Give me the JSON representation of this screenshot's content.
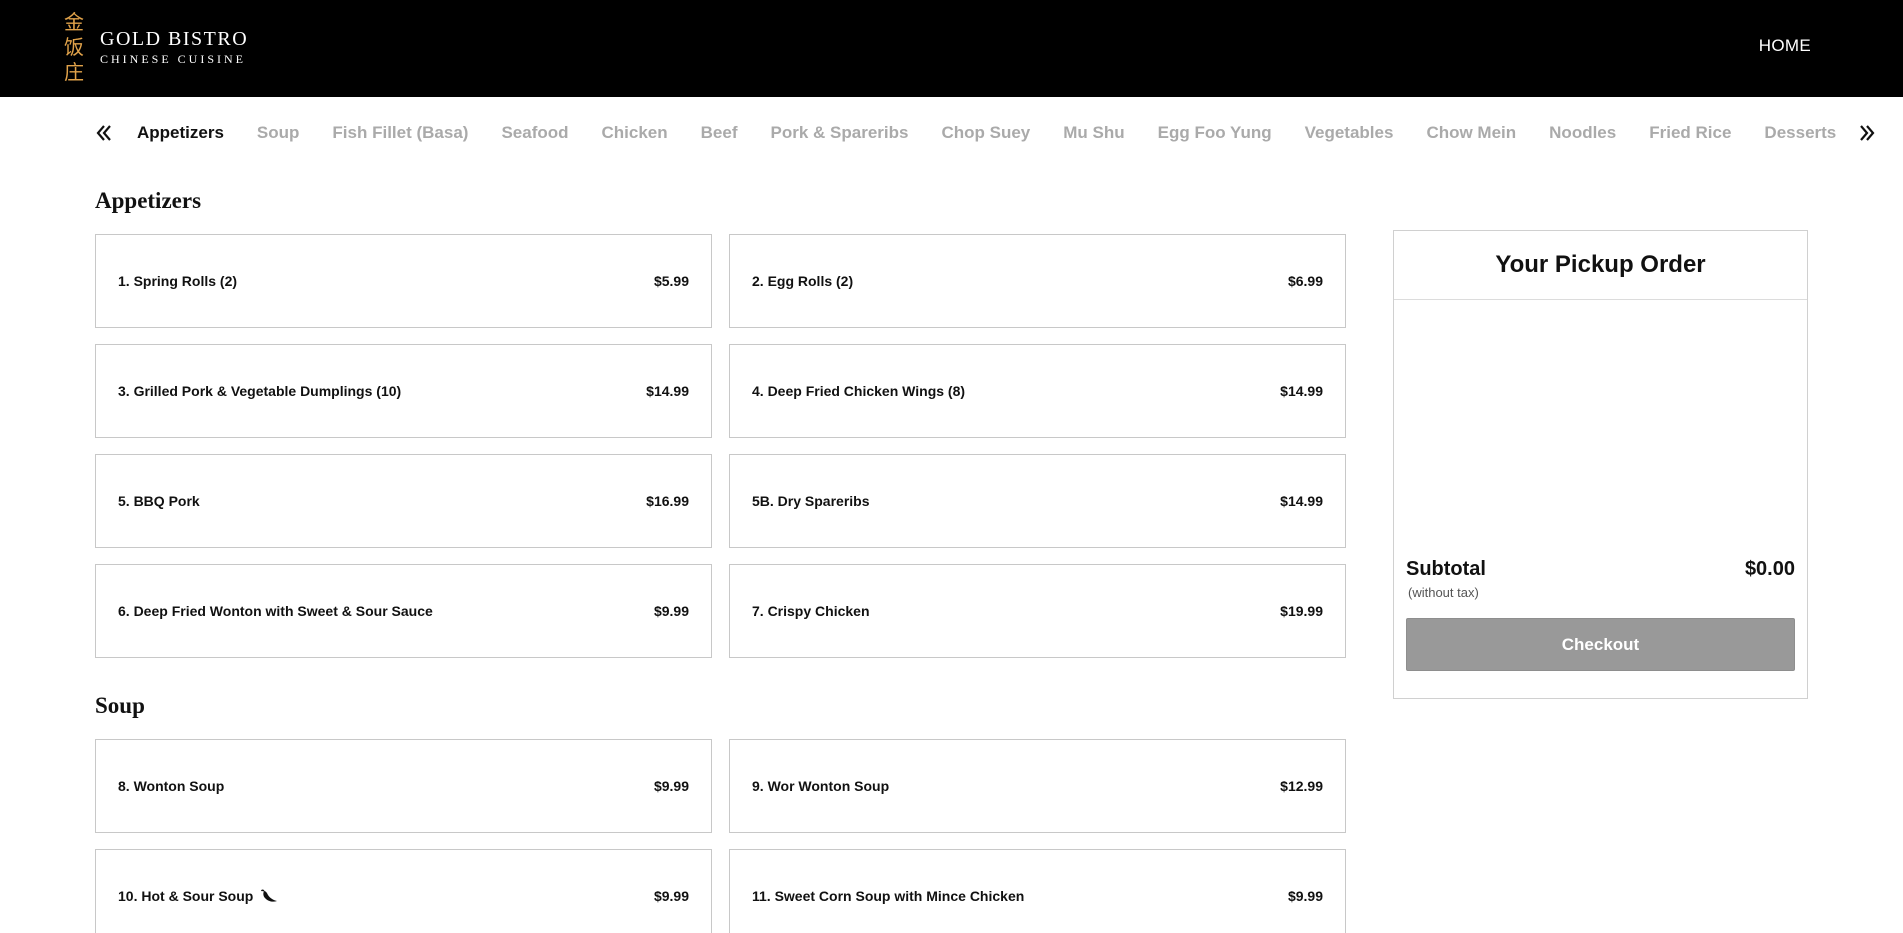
{
  "brand": {
    "chars": [
      "金",
      "饭",
      "庄"
    ],
    "name": "GOLD BISTRO",
    "tagline": "CHINESE CUISINE",
    "accent_color": "#e0a24a"
  },
  "nav": {
    "home_label": "HOME"
  },
  "categories": {
    "prev_icon": "double-chevron-left-icon",
    "next_icon": "double-chevron-right-icon",
    "tabs": [
      "Appetizers",
      "Soup",
      "Fish Fillet (Basa)",
      "Seafood",
      "Chicken",
      "Beef",
      "Pork & Spareribs",
      "Chop Suey",
      "Mu Shu",
      "Egg Foo Yung",
      "Vegetables",
      "Chow Mein",
      "Noodles",
      "Fried Rice",
      "Desserts"
    ],
    "active": "Appetizers"
  },
  "sections": [
    {
      "title": "Appetizers",
      "items": [
        {
          "name": "1. Spring Rolls (2)",
          "price": "$5.99"
        },
        {
          "name": "2. Egg Rolls (2)",
          "price": "$6.99"
        },
        {
          "name": "3. Grilled Pork & Vegetable Dumplings (10)",
          "price": "$14.99"
        },
        {
          "name": "4. Deep Fried Chicken Wings (8)",
          "price": "$14.99"
        },
        {
          "name": "5. BBQ Pork",
          "price": "$16.99"
        },
        {
          "name": "5B. Dry Spareribs",
          "price": "$14.99"
        },
        {
          "name": "6. Deep Fried Wonton with Sweet & Sour Sauce",
          "price": "$9.99"
        },
        {
          "name": "7. Crispy Chicken",
          "price": "$19.99"
        }
      ]
    },
    {
      "title": "Soup",
      "items": [
        {
          "name": "8. Wonton Soup",
          "price": "$9.99"
        },
        {
          "name": "9. Wor Wonton Soup",
          "price": "$12.99"
        },
        {
          "name": "10. Hot & Sour Soup",
          "price": "$9.99",
          "icon": "chili-pepper-icon"
        },
        {
          "name": "11. Sweet Corn Soup with Mince Chicken",
          "price": "$9.99"
        }
      ]
    }
  ],
  "order": {
    "title": "Your Pickup Order",
    "subtotal_label": "Subtotal",
    "subtotal_value": "$0.00",
    "tax_note": "(without tax)",
    "checkout_label": "Checkout",
    "checkout_color": "#999999"
  }
}
